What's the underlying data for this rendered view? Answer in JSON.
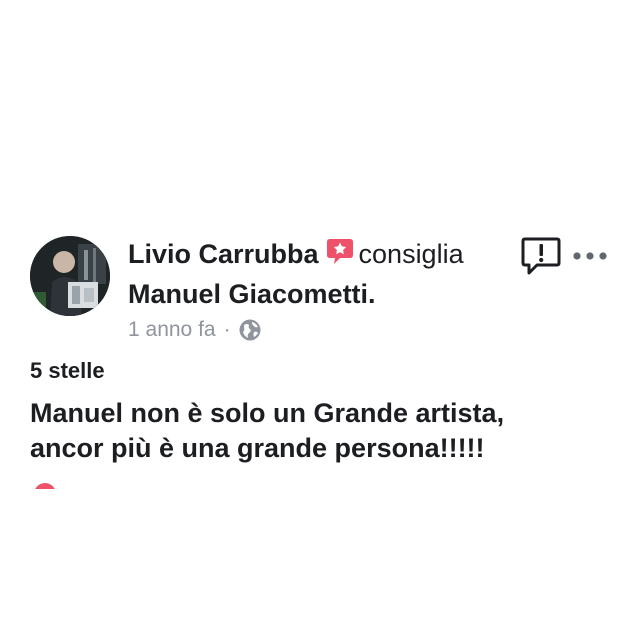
{
  "post": {
    "author": "Livio Carrubba",
    "action": "consiglia",
    "page": "Manuel Giacometti",
    "page_suffix": ".",
    "timestamp": "1 anno fa",
    "separator": "·",
    "audience_icon": "globe-icon",
    "rating": "5 stelle",
    "review_lines": [
      "Manuel non è solo un Grande artista,",
      "ancor più è una grande persona!!!!!"
    ]
  },
  "icons": {
    "recommendation_badge": "star-speech-bubble-icon",
    "report": "report-exclamation-icon",
    "more": "more-options-icon",
    "reaction": "love-reaction-icon"
  },
  "colors": {
    "text": "#1c1e21",
    "meta": "#90949c",
    "recommend_badge": "#f0516a"
  }
}
